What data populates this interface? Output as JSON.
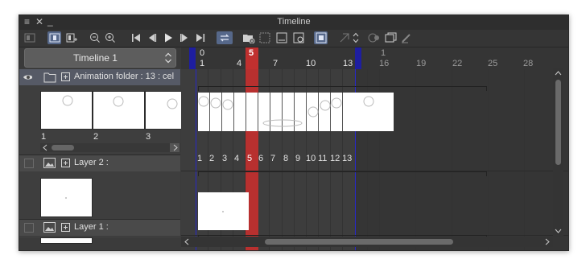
{
  "window": {
    "title": "Timeline"
  },
  "timeline_select": {
    "value": "Timeline 1"
  },
  "ruler": {
    "start_marker": "0",
    "current_frame": "5",
    "end_marker": "1",
    "ticks": [
      "1",
      "4",
      "7",
      "10",
      "13",
      "16",
      "19",
      "22",
      "25",
      "28"
    ]
  },
  "layers": [
    {
      "name": "Animation folder : 13 : cel",
      "cells": [
        "1",
        "2",
        "3"
      ]
    },
    {
      "name": "Layer 2 :"
    },
    {
      "name": "Layer 1 :"
    }
  ],
  "frame_numbers": [
    "1",
    "2",
    "3",
    "4",
    "5",
    "6",
    "7",
    "8",
    "9",
    "10",
    "11",
    "12",
    "13"
  ],
  "colors": {
    "accent": "#4a6cb3",
    "playhead": "#c0302f",
    "range_marker": "#1e1ea0"
  },
  "icons": [
    "menu-icon",
    "close-icon",
    "minimize-icon",
    "new-timeline-icon",
    "onion-skin-icon",
    "new-cel-icon",
    "zoom-out-icon",
    "zoom-in-icon",
    "first-frame-icon",
    "previous-frame-icon",
    "play-icon",
    "next-frame-icon",
    "last-frame-icon",
    "loop-icon",
    "new-animation-folder-icon",
    "new-cel-specify-icon",
    "assign-cel-icon",
    "light-table-icon",
    "enable-onion-icon",
    "camera-work-icon",
    "up-down-icon",
    "show-all-icon",
    "layer-cels-icon",
    "clear-icon"
  ]
}
